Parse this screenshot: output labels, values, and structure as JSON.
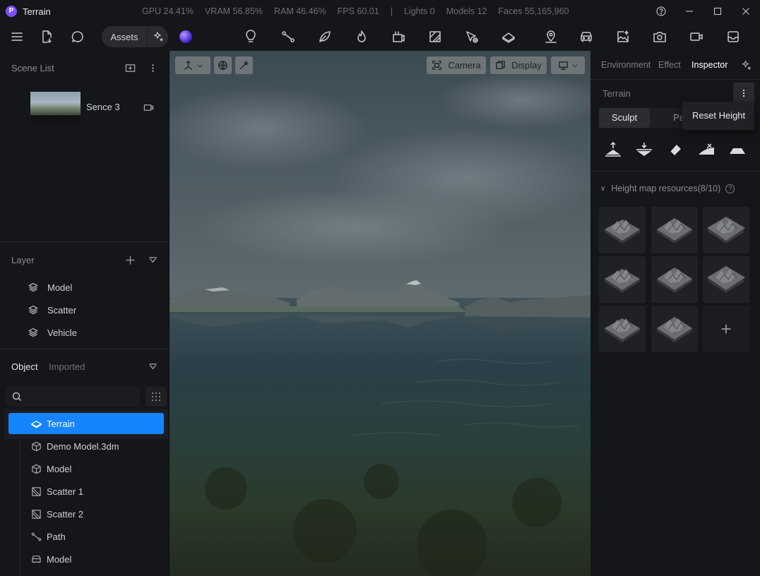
{
  "app": {
    "title": "Terrain"
  },
  "stats": [
    "GPU 24.41%",
    "VRAM 56.85%",
    "RAM 46.46%",
    "FPS 60.01",
    "|",
    "Lights 0",
    "Models 12",
    "Faces 55,165,960"
  ],
  "toolbar": {
    "assets_label": "Assets",
    "tools": [
      "light-bulb-icon",
      "path-icon",
      "leaf-icon",
      "fire-icon",
      "vehicle-cut-icon",
      "texture-icon",
      "select-add-icon",
      "terrain-icon",
      "map-pin-icon",
      "car-icon",
      "image-spark-icon",
      "camera-icon",
      "video-icon",
      "inbox-icon"
    ]
  },
  "scene_list": {
    "title": "Scene List",
    "scenes": [
      {
        "name": "Sence 3"
      }
    ]
  },
  "layer": {
    "title": "Layer",
    "items": [
      "Model",
      "Scatter",
      "Vehicle"
    ]
  },
  "object": {
    "tabs": [
      "Object",
      "Imported"
    ],
    "search": {
      "value": "",
      "placeholder": ""
    },
    "tree": [
      {
        "label": "Terrain",
        "icon": "terrain-icon",
        "selected": true
      },
      {
        "label": "Demo Model.3dm",
        "icon": "cube-icon"
      },
      {
        "label": "Model",
        "icon": "cube-icon"
      },
      {
        "label": "Scatter 1",
        "icon": "scatter-icon"
      },
      {
        "label": "Scatter 2",
        "icon": "scatter-icon"
      },
      {
        "label": "Path",
        "icon": "path-icon"
      },
      {
        "label": "Model",
        "icon": "car-icon"
      }
    ]
  },
  "viewport": {
    "camera_label": "Camera",
    "display_label": "Display"
  },
  "inspector": {
    "tabs": [
      "Environment",
      "Effect",
      "Inspector"
    ],
    "active_tab": "Inspector",
    "section_title": "Terrain",
    "modes": [
      "Sculpt",
      "Paint"
    ],
    "active_mode": "Sculpt",
    "menu_item": "Reset Height",
    "sculpt_tools": [
      "raise-icon",
      "lower-icon",
      "eraser-icon",
      "smooth-icon",
      "flatten-icon"
    ],
    "heightmap": {
      "title": "Height map resources(8/10)",
      "count": 8
    }
  },
  "colors": {
    "accent": "#1684fc",
    "panel": "#151619",
    "viewport_button": "#6e7579"
  }
}
